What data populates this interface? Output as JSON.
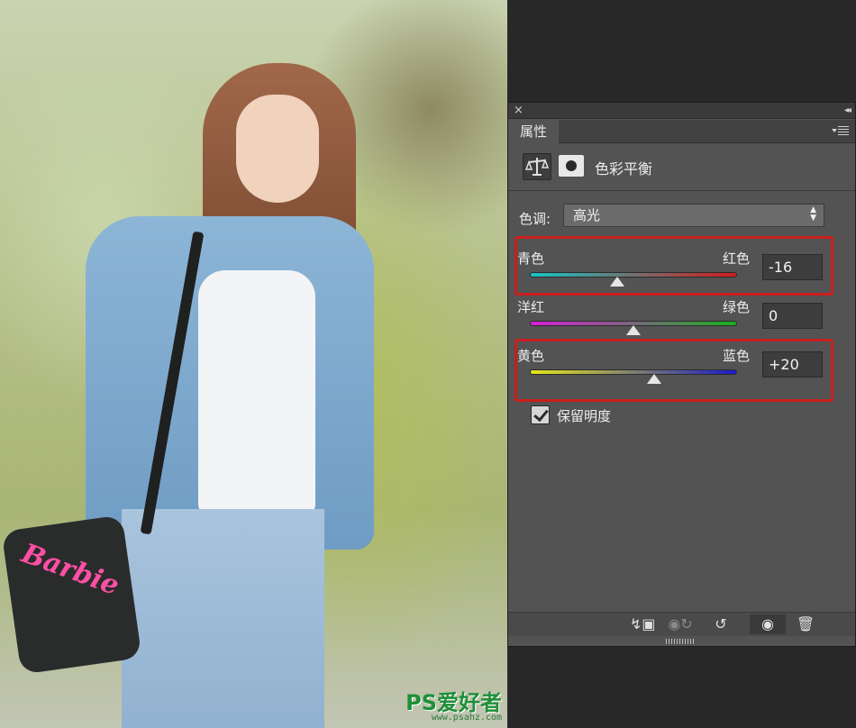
{
  "photo": {
    "bag_text": "Barbie",
    "watermark_main": "PS爱好者",
    "watermark_url": "www.psahz.com"
  },
  "panel": {
    "close_glyph": "×",
    "collapse_glyph": "◂◂",
    "tab_label": "属性",
    "adjustment_title": "色彩平衡",
    "tone": {
      "label": "色调:",
      "value": "高光"
    },
    "sliders": [
      {
        "left_label": "青色",
        "right_label": "红色",
        "value": "-16",
        "level": -16,
        "colors": [
          "#16c4c4",
          "#d11c1c"
        ]
      },
      {
        "left_label": "洋红",
        "right_label": "绿色",
        "value": "0",
        "level": 0,
        "colors": [
          "#d61fd6",
          "#19b01f"
        ]
      },
      {
        "left_label": "黄色",
        "right_label": "蓝色",
        "value": "+20",
        "level": 20,
        "colors": [
          "#e6e61a",
          "#1a1ac8"
        ]
      }
    ],
    "highlight_color": "#c81e1e",
    "preserve_luminosity": {
      "label": "保留明度",
      "checked": true
    },
    "footer_icons": [
      "clip-to-layer-icon",
      "view-previous-icon",
      "reset-icon",
      "visibility-eye-icon",
      "trash-icon"
    ]
  }
}
